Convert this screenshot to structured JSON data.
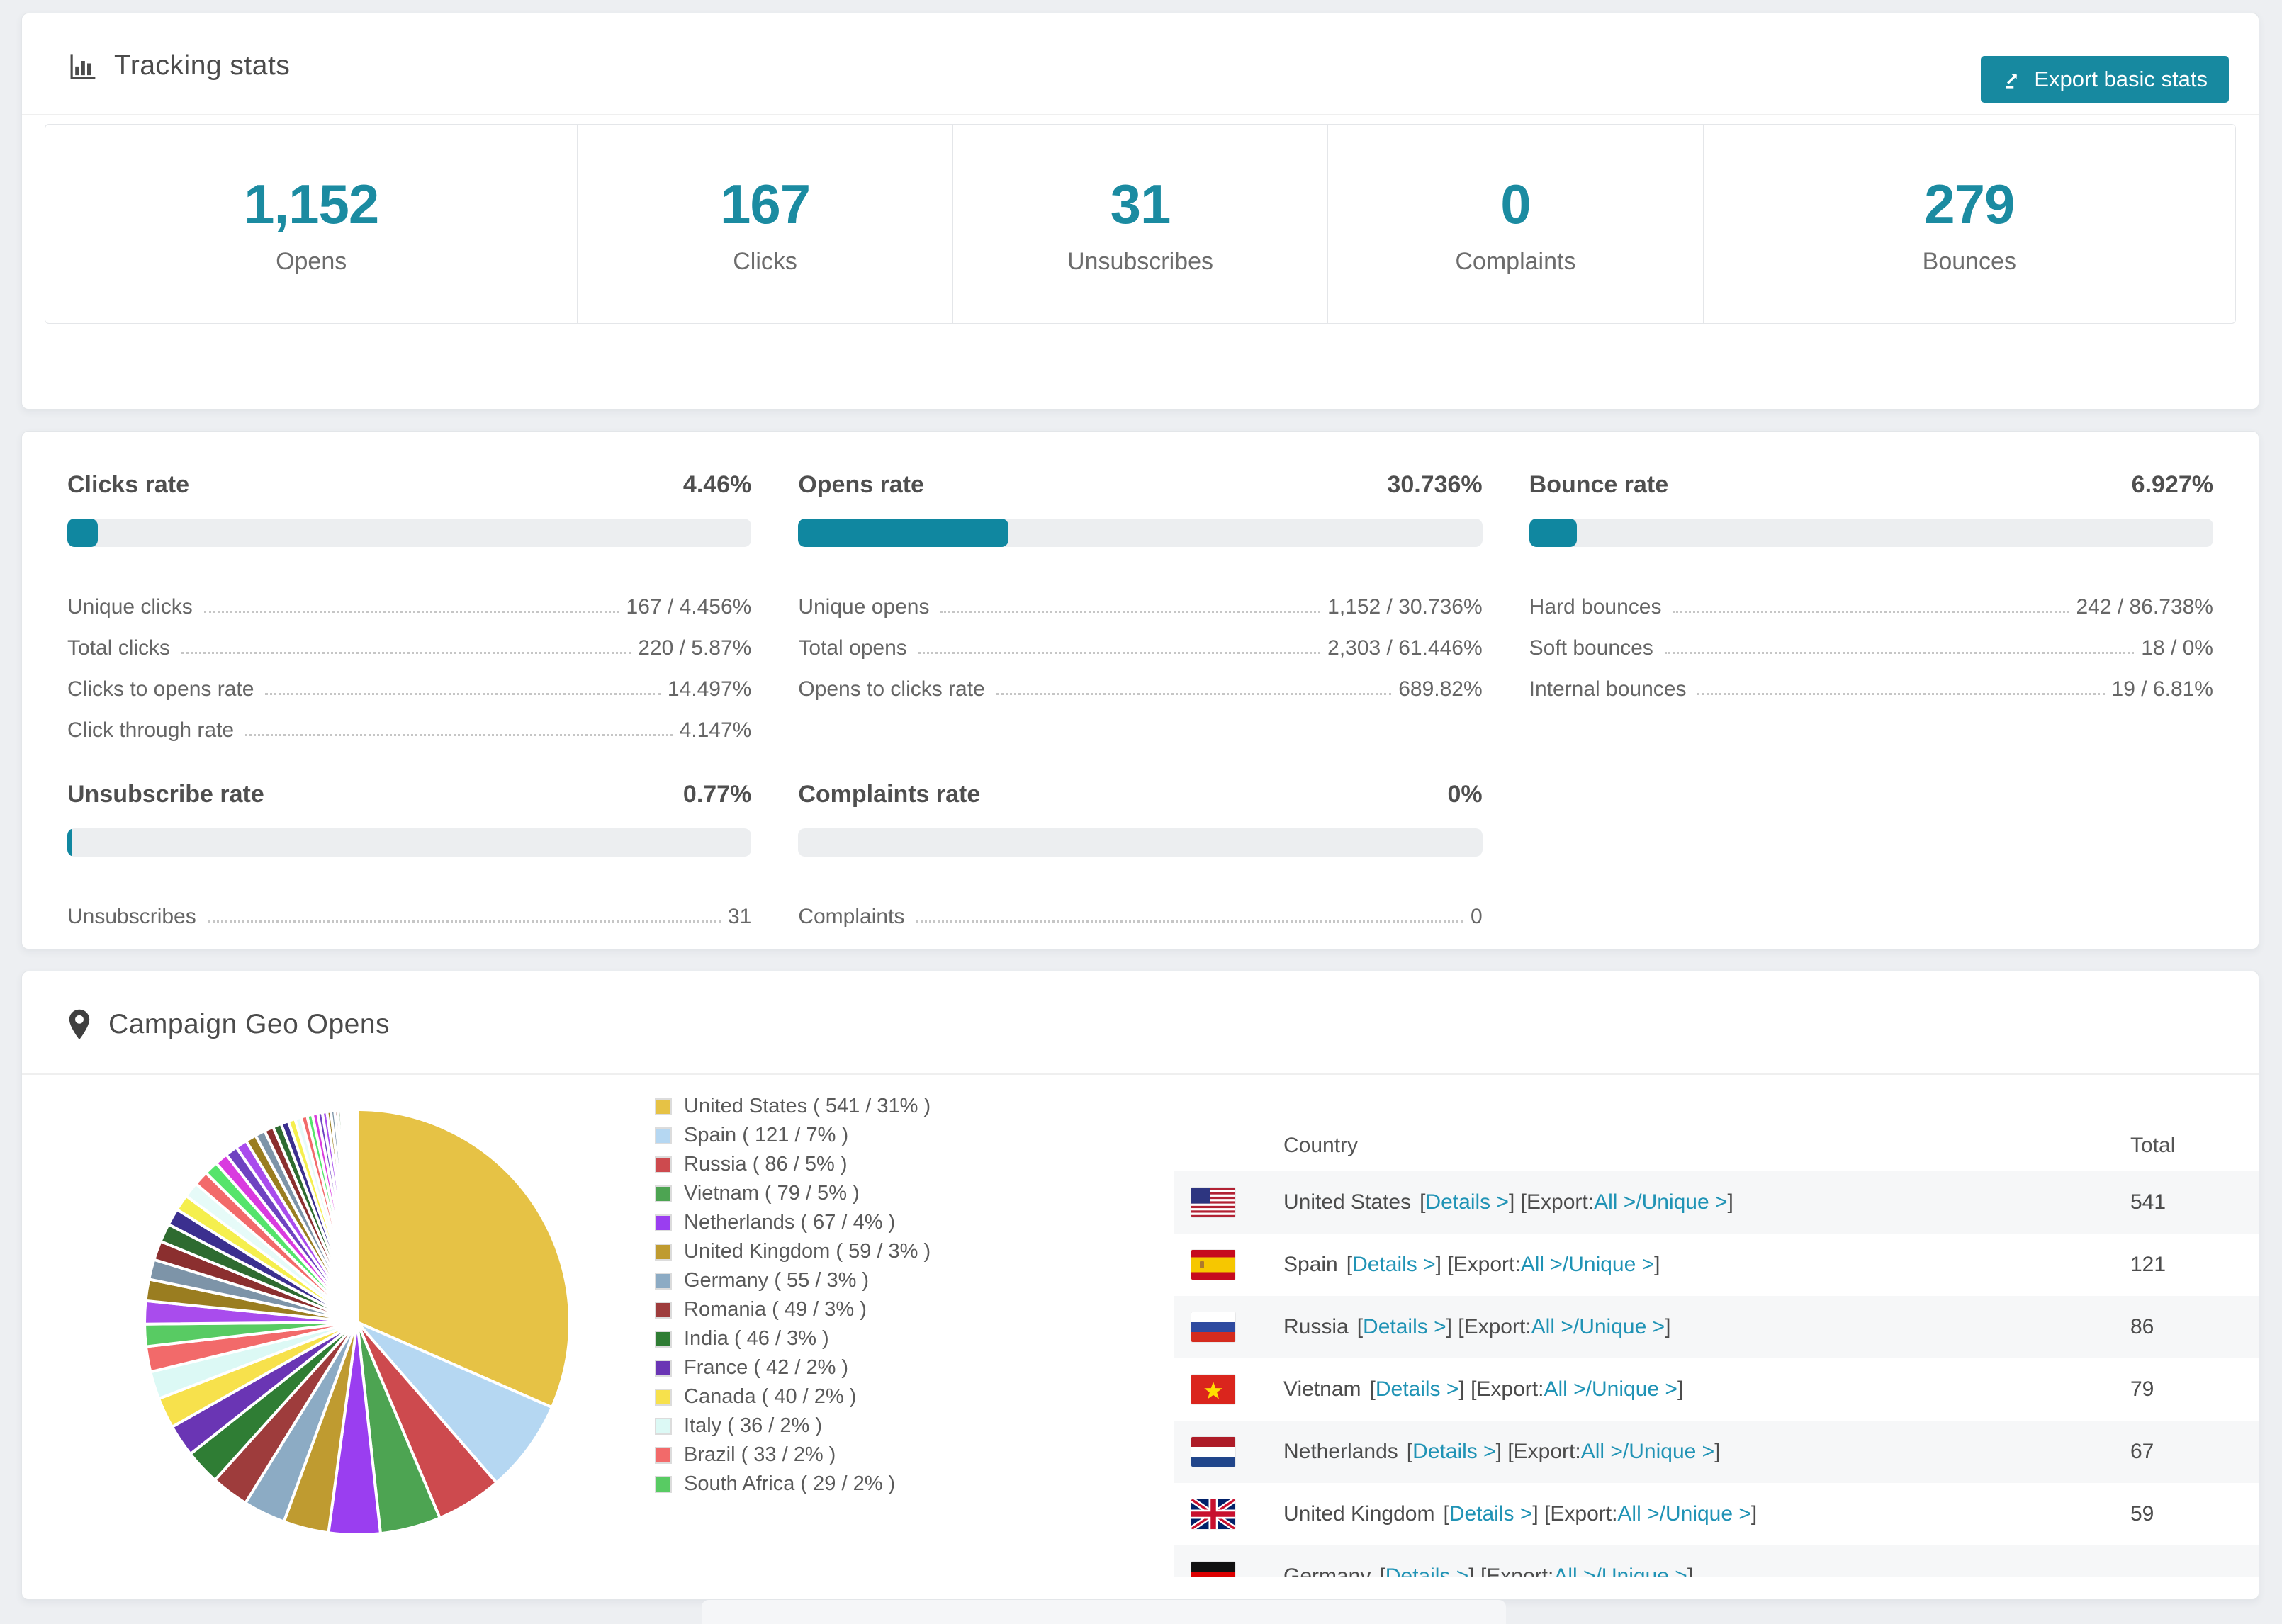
{
  "colors": {
    "accent": "#1087a0",
    "accent_text": "#1b8ba1",
    "link": "#2093b5",
    "track": "#eceef0"
  },
  "tracking": {
    "title": "Tracking stats",
    "export_button": "Export basic stats",
    "stats": [
      {
        "value": "1,152",
        "label": "Opens"
      },
      {
        "value": "167",
        "label": "Clicks"
      },
      {
        "value": "31",
        "label": "Unsubscribes"
      },
      {
        "value": "0",
        "label": "Complaints"
      },
      {
        "value": "279",
        "label": "Bounces"
      }
    ]
  },
  "rates": {
    "panels": [
      {
        "title": "Clicks rate",
        "value": "4.46%",
        "percent": 4.46,
        "rows": [
          {
            "label": "Unique clicks",
            "value": "167 / 4.456%"
          },
          {
            "label": "Total clicks",
            "value": "220 / 5.87%"
          },
          {
            "label": "Clicks to opens rate",
            "value": "14.497%"
          },
          {
            "label": "Click through rate",
            "value": "4.147%"
          }
        ]
      },
      {
        "title": "Opens rate",
        "value": "30.736%",
        "percent": 30.736,
        "rows": [
          {
            "label": "Unique opens",
            "value": "1,152 / 30.736%"
          },
          {
            "label": "Total opens",
            "value": "2,303 / 61.446%"
          },
          {
            "label": "Opens to clicks rate",
            "value": "689.82%"
          }
        ]
      },
      {
        "title": "Bounce rate",
        "value": "6.927%",
        "percent": 6.927,
        "rows": [
          {
            "label": "Hard bounces",
            "value": "242 / 86.738%"
          },
          {
            "label": "Soft bounces",
            "value": "18 / 0%"
          },
          {
            "label": "Internal bounces",
            "value": "19 / 6.81%"
          }
        ]
      },
      {
        "title": "Unsubscribe rate",
        "value": "0.77%",
        "percent": 0.77,
        "rows": [
          {
            "label": "Unsubscribes",
            "value": "31"
          }
        ]
      },
      {
        "title": "Complaints rate",
        "value": "0%",
        "percent": 0,
        "rows": [
          {
            "label": "Complaints",
            "value": "0"
          }
        ]
      }
    ]
  },
  "geo": {
    "title": "Campaign Geo Opens",
    "table": {
      "columns": [
        "Country",
        "Total"
      ],
      "link_labels": {
        "details": "Details >",
        "export_prefix": "[Export: ",
        "all": "All >",
        "separator": " / ",
        "unique": "Unique >",
        "open": "[",
        "close": "]"
      },
      "rows": [
        {
          "flag": "us",
          "country": "United States",
          "total": "541"
        },
        {
          "flag": "es",
          "country": "Spain",
          "total": "121"
        },
        {
          "flag": "ru",
          "country": "Russia",
          "total": "86"
        },
        {
          "flag": "vn",
          "country": "Vietnam",
          "total": "79"
        },
        {
          "flag": "nl",
          "country": "Netherlands",
          "total": "67"
        },
        {
          "flag": "gb",
          "country": "United Kingdom",
          "total": "59"
        },
        {
          "flag": "de",
          "country": "Germany",
          "total": "",
          "partial": true
        }
      ]
    }
  },
  "chart_data": {
    "type": "pie",
    "title": "Campaign Geo Opens",
    "legend_position": "right",
    "start_angle_deg": -90,
    "direction": "clockwise",
    "labels": [
      "United States",
      "Spain",
      "Russia",
      "Vietnam",
      "Netherlands",
      "United Kingdom",
      "Germany",
      "Romania",
      "India",
      "France",
      "Canada",
      "Italy",
      "Brazil",
      "South Africa"
    ],
    "values": [
      541,
      121,
      86,
      79,
      67,
      59,
      55,
      49,
      46,
      42,
      40,
      36,
      33,
      29
    ],
    "percent_labels": [
      "31%",
      "7%",
      "5%",
      "5%",
      "4%",
      "3%",
      "3%",
      "3%",
      "3%",
      "2%",
      "2%",
      "2%",
      "2%",
      "2%"
    ],
    "colors": [
      "#e6c245",
      "#b5d7f2",
      "#cd4a4e",
      "#4da452",
      "#9a3ef0",
      "#bf9b30",
      "#8cabc4",
      "#9e3c3c",
      "#2f7d34",
      "#6a35b4",
      "#f7e14c",
      "#dcf9f5",
      "#f26a6a",
      "#58cb63"
    ],
    "legend_format": "{label} ( {value} / {percent} )",
    "unlabeled_slices": {
      "note": "remaining small unlabeled countries, visual estimate",
      "values": [
        30,
        28,
        26,
        25,
        24,
        22,
        21,
        20,
        19,
        18,
        17,
        16,
        15,
        14,
        13,
        12,
        11,
        10,
        9,
        8,
        8,
        7,
        7,
        6,
        6,
        5,
        5,
        4,
        4,
        3,
        3,
        3,
        2,
        2,
        2,
        2,
        1,
        1,
        1,
        1
      ],
      "colors": [
        "#a94ced",
        "#9a7d20",
        "#7d94a8",
        "#8b2f2f",
        "#2e6b30",
        "#3b2f8f",
        "#f5ef4e",
        "#e6fbf8",
        "#f26a6a",
        "#55e46b",
        "#d93bdf",
        "#6f42c1"
      ]
    }
  }
}
